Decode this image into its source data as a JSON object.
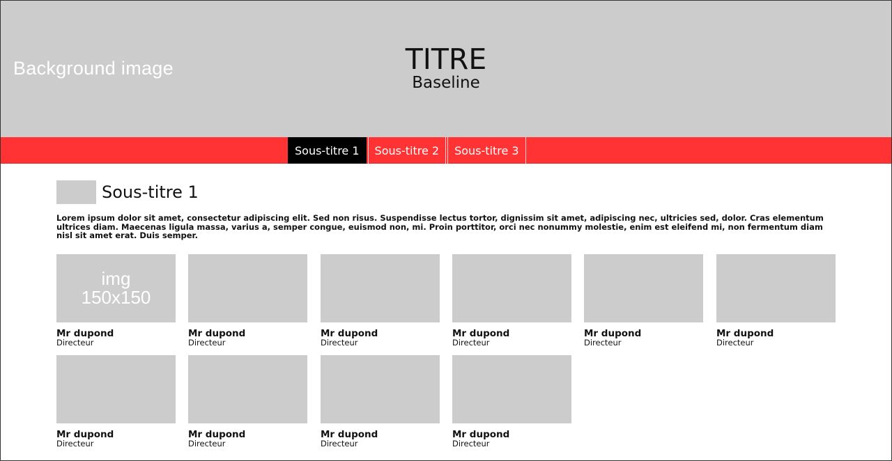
{
  "header": {
    "background_label": "Background image",
    "title": "TITRE",
    "baseline": "Baseline"
  },
  "nav": {
    "tabs": [
      {
        "label": "Sous-titre 1",
        "active": true
      },
      {
        "label": "Sous-titre 2",
        "active": false
      },
      {
        "label": "Sous-titre 3",
        "active": false
      }
    ]
  },
  "section": {
    "title": "Sous-titre 1",
    "text": "Lorem ipsum dolor sit amet, consectetur adipiscing elit. Sed non risus. Suspendisse lectus tortor, dignissim sit amet, adipiscing nec, ultricies sed, dolor. Cras elementum ultrices diam. Maecenas ligula massa, varius a, semper congue, euismod non, mi. Proin porttitor, orci nec nonummy molestie, enim est eleifend mi, non fermentum diam nisl sit amet erat. Duis semper."
  },
  "people": [
    {
      "img_label": "img\n150x150",
      "name": "Mr dupond",
      "role": "Directeur"
    },
    {
      "img_label": "",
      "name": "Mr dupond",
      "role": "Directeur"
    },
    {
      "img_label": "",
      "name": "Mr dupond",
      "role": "Directeur"
    },
    {
      "img_label": "",
      "name": "Mr dupond",
      "role": "Directeur"
    },
    {
      "img_label": "",
      "name": "Mr dupond",
      "role": "Directeur"
    },
    {
      "img_label": "",
      "name": "Mr dupond",
      "role": "Directeur"
    },
    {
      "img_label": "",
      "name": "Mr dupond",
      "role": "Directeur"
    },
    {
      "img_label": "",
      "name": "Mr dupond",
      "role": "Directeur"
    },
    {
      "img_label": "",
      "name": "Mr dupond",
      "role": "Directeur"
    },
    {
      "img_label": "",
      "name": "Mr dupond",
      "role": "Directeur"
    }
  ],
  "colors": {
    "accent": "#ff3333",
    "active_tab": "#000000",
    "placeholder": "#cccccc"
  }
}
